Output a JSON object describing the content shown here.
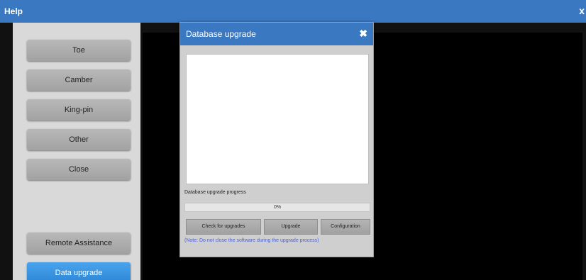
{
  "window": {
    "title": "Help",
    "close_glyph": "x"
  },
  "sidebar": {
    "items": [
      {
        "label": "Toe"
      },
      {
        "label": "Camber"
      },
      {
        "label": "King-pin"
      },
      {
        "label": "Other"
      },
      {
        "label": "Close"
      }
    ],
    "remote_assistance_label": "Remote Assistance",
    "data_upgrade_label": "Data upgrade"
  },
  "dialog": {
    "title": "Database upgrade",
    "close_glyph": "✖",
    "progress_label": "Database upgrade progress",
    "progress_percent_text": "0%",
    "progress_value": 0,
    "buttons": {
      "check": "Check for upgrades",
      "upgrade": "Upgrade",
      "configuration": "Configuration"
    },
    "note": "(Note: Do not close the software during the upgrade process)"
  },
  "colors": {
    "title_bar": "#3b78c2",
    "accent_button": "#2c86d6",
    "note_text": "#4b5fd1"
  }
}
